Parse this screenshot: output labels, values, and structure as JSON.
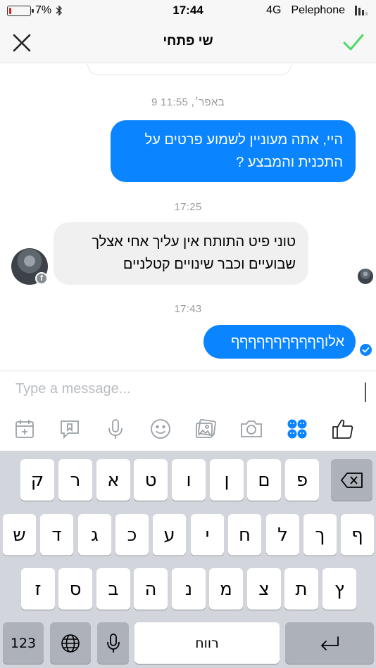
{
  "status_bar": {
    "battery": "7%",
    "time": "17:44",
    "network": "4G",
    "carrier": "Pelephone"
  },
  "header": {
    "title": "שי פתחי",
    "close_icon": "close-icon",
    "confirm_icon": "checkmark-icon",
    "confirm_color": "#4cd964"
  },
  "chat": {
    "timestamps": [
      "9 באפר׳, 11:55",
      "17:25",
      "17:43"
    ],
    "messages": [
      {
        "direction": "out",
        "text": "היי, אתה מעוניין לשמוע פרטים על התכנית והמבצע ?"
      },
      {
        "direction": "in",
        "text": "טוני פיט התותח אין עליך אחי אצלך שבועיים וכבר שינויים קטלניים"
      },
      {
        "direction": "out",
        "text": "אלוףףףףףףףףףףף"
      }
    ],
    "outgoing_color": "#0a84ff",
    "incoming_color": "#f1f0f0"
  },
  "composer": {
    "placeholder": "Type a message..."
  },
  "toolbar": {
    "icons": [
      "calendar-add-icon",
      "bookmark-chat-icon",
      "microphone-icon",
      "smiley-icon",
      "photos-icon",
      "camera-icon",
      "stickers-icon",
      "thumbs-up-icon"
    ]
  },
  "keyboard": {
    "row1": [
      "פ",
      "ם",
      "ן",
      "ו",
      "ט",
      "א",
      "ר",
      "ק"
    ],
    "row2": [
      "ף",
      "ך",
      "ל",
      "ח",
      "י",
      "ע",
      "כ",
      "ג",
      "ד",
      "ש"
    ],
    "row3": [
      "ץ",
      "ת",
      "צ",
      "מ",
      "נ",
      "ה",
      "ב",
      "ס",
      "ז"
    ],
    "numbers_label": "123",
    "space_label": "רווח"
  }
}
